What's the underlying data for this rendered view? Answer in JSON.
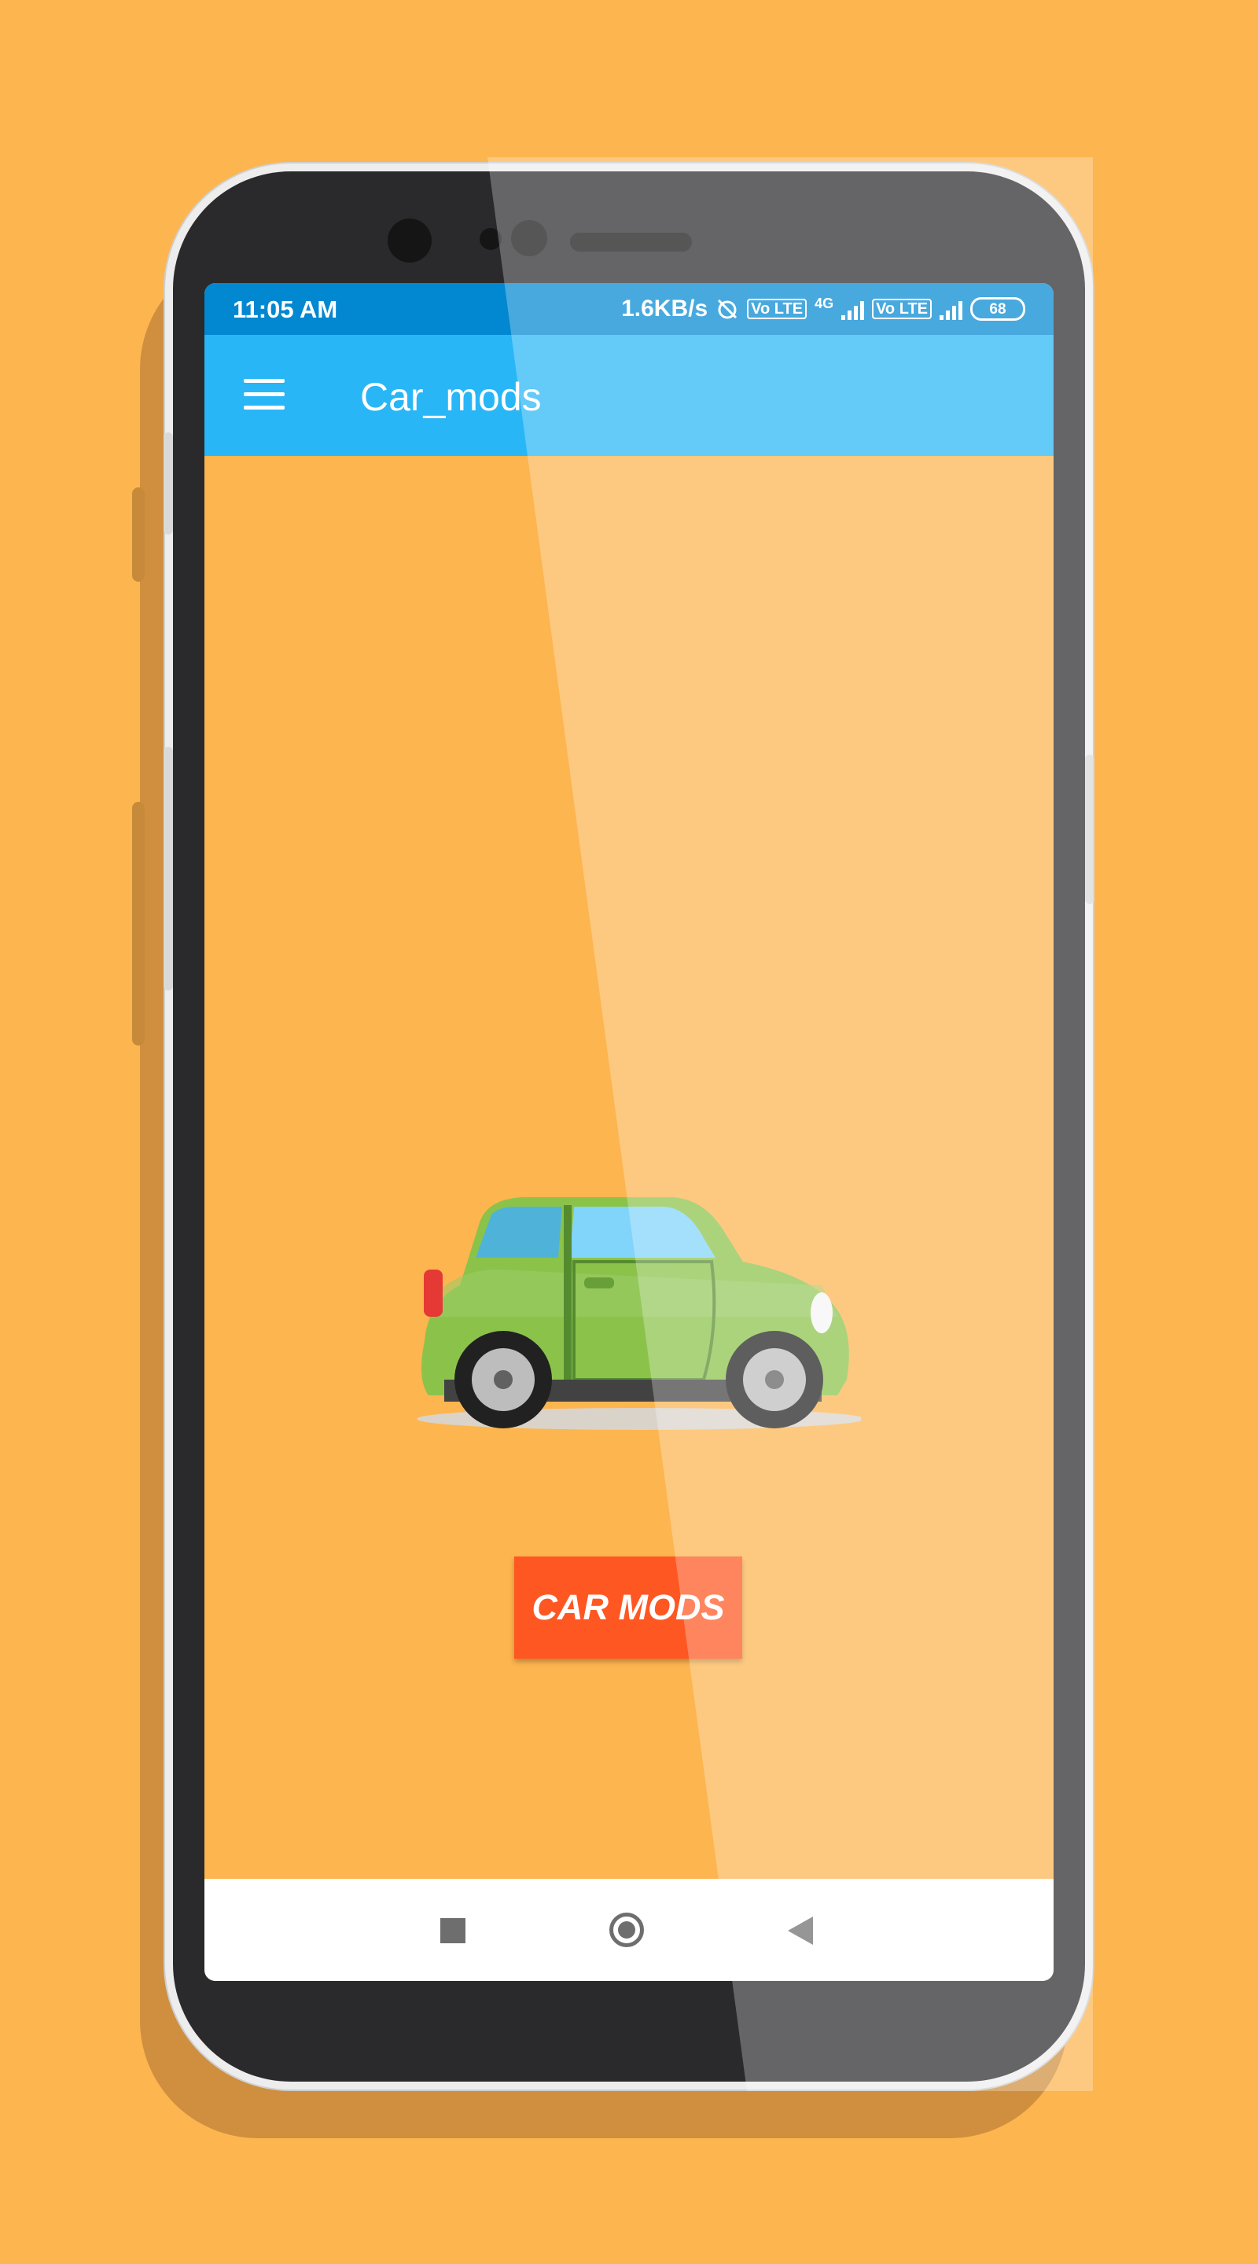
{
  "colors": {
    "background": "#FDB54F",
    "status_bar": "#0288D1",
    "app_bar": "#29B6F6",
    "button": "#FF5722",
    "car_body": "#8BC34A"
  },
  "status_bar": {
    "time": "11:05 AM",
    "network_speed": "1.6KB/s",
    "volte_1": "Vo LTE",
    "network_type": "4G",
    "volte_2": "Vo LTE",
    "battery": "68"
  },
  "app_bar": {
    "menu_icon": "hamburger-menu-icon",
    "title": "Car_mods"
  },
  "main": {
    "car_image": "car-illustration",
    "button_label": "CAR MODS"
  },
  "nav_bar": {
    "recents_icon": "square-icon",
    "home_icon": "circle-icon",
    "back_icon": "triangle-back-icon"
  }
}
